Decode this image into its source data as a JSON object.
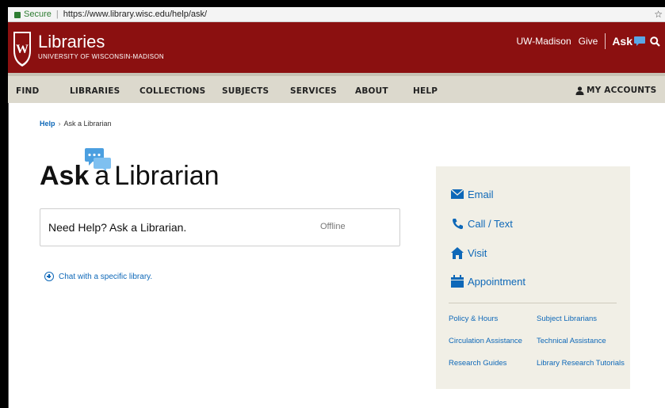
{
  "browser": {
    "secure_label": "Secure",
    "url": "https://www.library.wisc.edu/help/ask/"
  },
  "header": {
    "brand_title": "Libraries",
    "brand_subtitle": "UNIVERSITY OF WISCONSIN-MADISON",
    "links": {
      "uw_madison": "UW-Madison",
      "give": "Give",
      "ask": "Ask"
    }
  },
  "nav": {
    "items": [
      "FIND",
      "LIBRARIES",
      "COLLECTIONS",
      "SUBJECTS",
      "SERVICES",
      "ABOUT",
      "HELP"
    ],
    "my_accounts": "MY ACCOUNTS"
  },
  "breadcrumb": {
    "help": "Help",
    "current": "Ask a Librarian"
  },
  "page_title": {
    "ask": "Ask",
    "a": "a",
    "librarian": "Librarian"
  },
  "chat": {
    "prompt": "Need Help? Ask a Librarian.",
    "status": "Offline"
  },
  "chat_specific": "Chat with a specific library.",
  "sidebar": {
    "contacts": [
      "Email",
      "Call / Text",
      "Visit",
      "Appointment"
    ],
    "links": [
      "Policy & Hours",
      "Subject Librarians",
      "Circulation Assistance",
      "Technical Assistance",
      "Research Guides",
      "Library Research Tutorials"
    ]
  },
  "colors": {
    "header_red": "#8b1010",
    "nav_beige": "#dcd9cd",
    "link_blue": "#0e68b8",
    "sidebar_bg": "#f1efe6"
  }
}
